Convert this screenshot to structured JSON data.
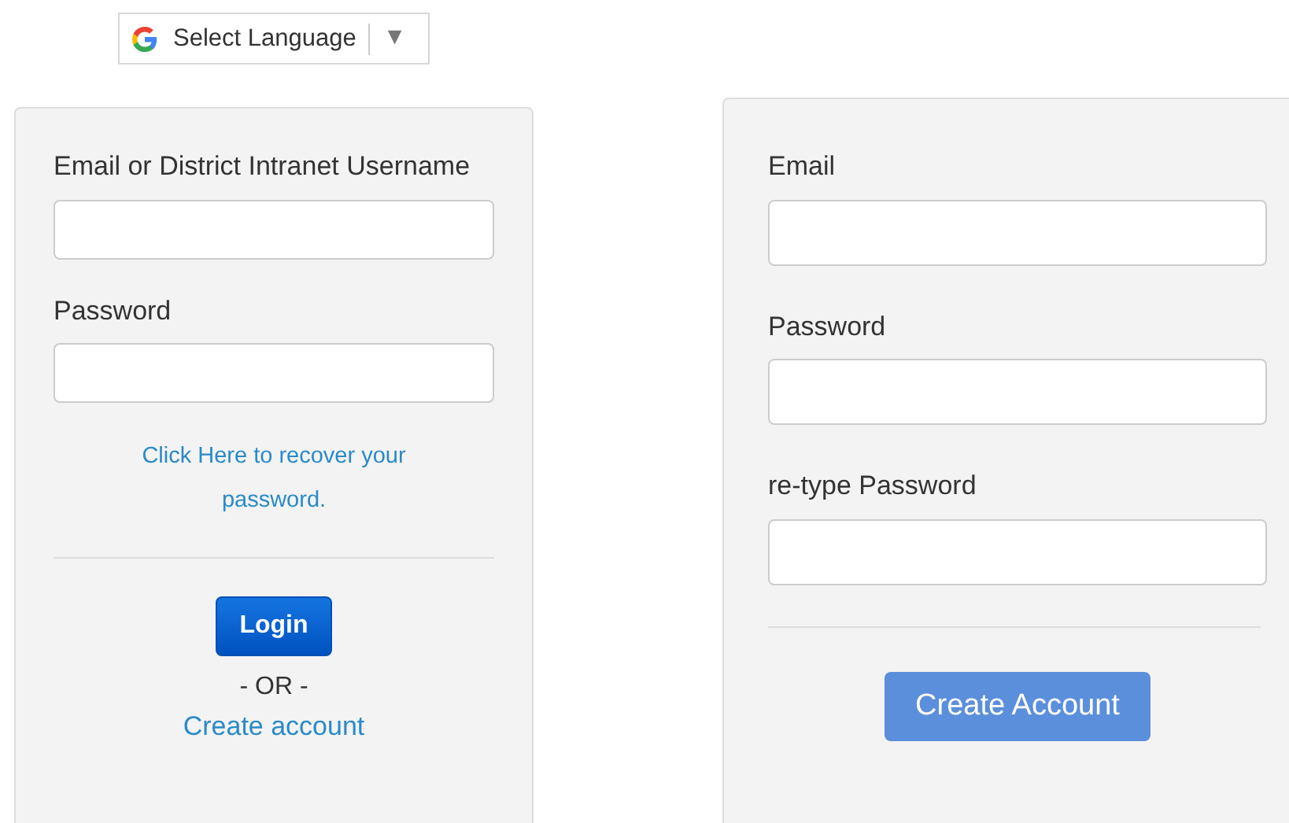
{
  "language_selector": {
    "label": "Select Language",
    "caret": "▼"
  },
  "login_panel": {
    "fields": [
      {
        "label": "Email or District Intranet Username"
      },
      {
        "label": "Password"
      }
    ],
    "recover_link": "Click Here to recover your password.",
    "login_button": "Login",
    "separator": "- OR -",
    "create_link": "Create account"
  },
  "signup_panel": {
    "fields": [
      {
        "label": "Email"
      },
      {
        "label": "Password"
      },
      {
        "label": "re-type Password"
      }
    ],
    "create_button": "Create Account"
  }
}
